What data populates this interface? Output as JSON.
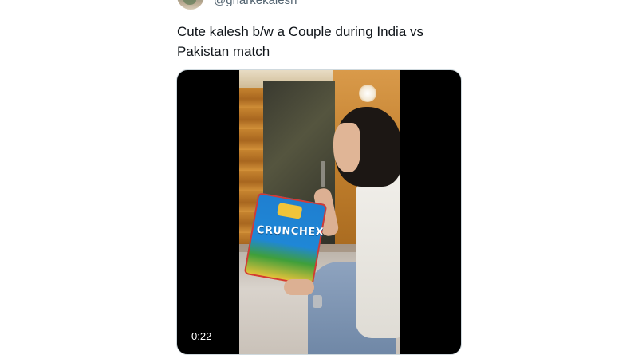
{
  "tweet": {
    "author_handle": "@gharkekalesh",
    "text": "Cute kalesh b/w a Couple during India vs Pakistan match",
    "media": {
      "type": "video",
      "duration": "0:22",
      "package_label": "CRUNCHEX"
    }
  },
  "colors": {
    "handle_gray": "#536471",
    "text_dark": "#0f1419",
    "media_background": "#000000"
  }
}
